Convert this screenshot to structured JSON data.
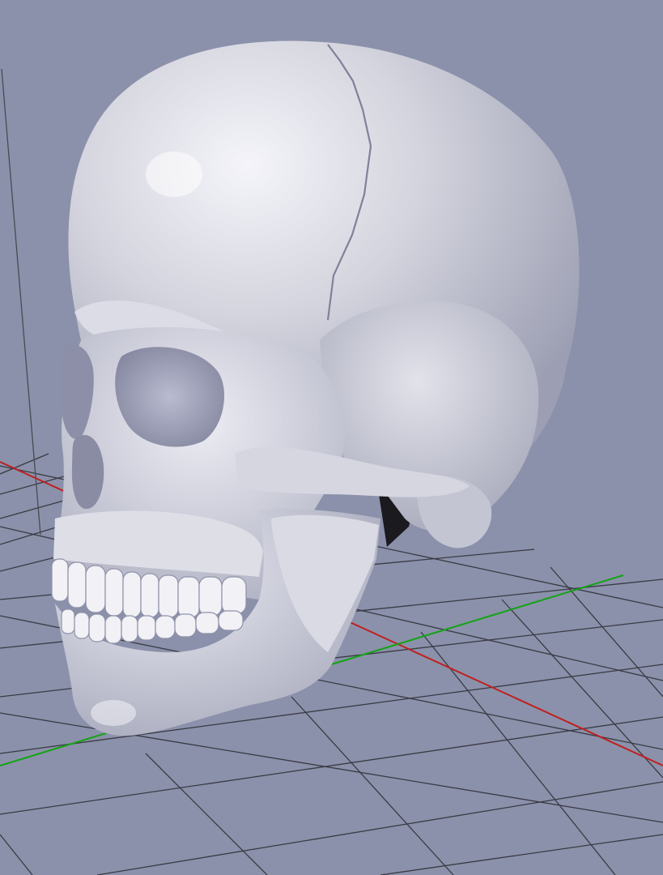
{
  "viewport": {
    "background": "#8b91aa",
    "grid_color": "#2b2b33",
    "x_axis_color": "#c02020",
    "y_axis_color": "#13a313",
    "z_axis_color": "#4a4a55",
    "model": "human-skull"
  },
  "model_colors": {
    "bone_light": "#eeeef6",
    "bone_mid": "#c9c9d6",
    "bone_shadow": "#8e90a6",
    "cavity": "#1a1a1f"
  }
}
